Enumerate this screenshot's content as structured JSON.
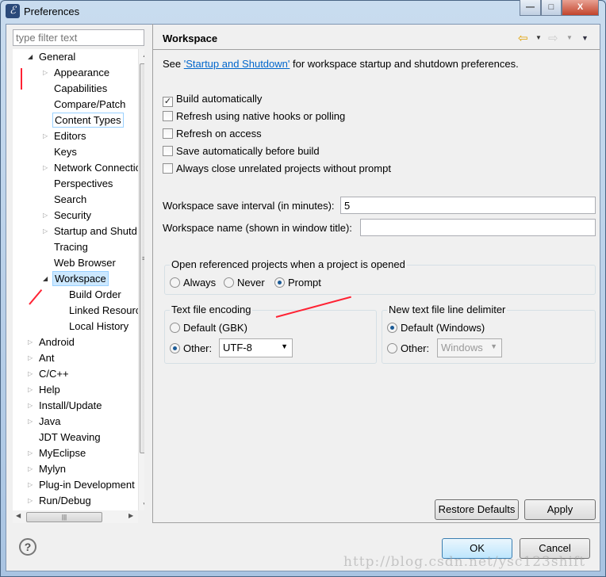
{
  "window": {
    "title": "Preferences",
    "minimize": "—",
    "maximize": "□",
    "close": "X"
  },
  "filter": {
    "placeholder": "type filter text"
  },
  "tree": [
    {
      "label": "General",
      "level": 0,
      "expander": "open"
    },
    {
      "label": "Appearance",
      "level": 1,
      "expander": "closed"
    },
    {
      "label": "Capabilities",
      "level": 1,
      "expander": "none"
    },
    {
      "label": "Compare/Patch",
      "level": 1,
      "expander": "none"
    },
    {
      "label": "Content Types",
      "level": 1,
      "expander": "none",
      "focused": true
    },
    {
      "label": "Editors",
      "level": 1,
      "expander": "closed"
    },
    {
      "label": "Keys",
      "level": 1,
      "expander": "none"
    },
    {
      "label": "Network Connectio",
      "level": 1,
      "expander": "closed"
    },
    {
      "label": "Perspectives",
      "level": 1,
      "expander": "none"
    },
    {
      "label": "Search",
      "level": 1,
      "expander": "none"
    },
    {
      "label": "Security",
      "level": 1,
      "expander": "closed"
    },
    {
      "label": "Startup and Shutd",
      "level": 1,
      "expander": "closed"
    },
    {
      "label": "Tracing",
      "level": 1,
      "expander": "none"
    },
    {
      "label": "Web Browser",
      "level": 1,
      "expander": "none"
    },
    {
      "label": "Workspace",
      "level": 1,
      "expander": "open",
      "selected": true
    },
    {
      "label": "Build Order",
      "level": 2,
      "expander": "none"
    },
    {
      "label": "Linked Resource",
      "level": 2,
      "expander": "none"
    },
    {
      "label": "Local History",
      "level": 2,
      "expander": "none"
    },
    {
      "label": "Android",
      "level": 0,
      "expander": "closed"
    },
    {
      "label": "Ant",
      "level": 0,
      "expander": "closed"
    },
    {
      "label": "C/C++",
      "level": 0,
      "expander": "closed"
    },
    {
      "label": "Help",
      "level": 0,
      "expander": "closed"
    },
    {
      "label": "Install/Update",
      "level": 0,
      "expander": "closed"
    },
    {
      "label": "Java",
      "level": 0,
      "expander": "closed"
    },
    {
      "label": "JDT Weaving",
      "level": 0,
      "expander": "none"
    },
    {
      "label": "MyEclipse",
      "level": 0,
      "expander": "closed"
    },
    {
      "label": "Mylyn",
      "level": 0,
      "expander": "closed"
    },
    {
      "label": "Plug-in Development",
      "level": 0,
      "expander": "closed"
    },
    {
      "label": "Run/Debug",
      "level": 0,
      "expander": "closed"
    }
  ],
  "page": {
    "title": "Workspace",
    "see_prefix": "See ",
    "see_link": "'Startup and Shutdown'",
    "see_suffix": " for workspace startup and shutdown preferences.",
    "checkboxes": [
      {
        "label": "Build automatically",
        "checked": true
      },
      {
        "label": "Refresh using native hooks or polling",
        "checked": false
      },
      {
        "label": "Refresh on access",
        "checked": false
      },
      {
        "label": "Save automatically before build",
        "checked": false
      },
      {
        "label": "Always close unrelated projects without prompt",
        "checked": false
      }
    ],
    "save_interval_label": "Workspace save interval (in minutes):",
    "save_interval_value": "5",
    "ws_name_label": "Workspace name (shown in window title):",
    "ws_name_value": "",
    "open_ref": {
      "label": "Open referenced projects when a project is opened",
      "options": [
        "Always",
        "Never",
        "Prompt"
      ],
      "selected": "Prompt"
    },
    "encoding": {
      "label": "Text file encoding",
      "default": "Default (GBK)",
      "other": "Other:",
      "value": "UTF-8",
      "selected": "Other"
    },
    "delimiter": {
      "label": "New text file line delimiter",
      "default": "Default (Windows)",
      "other": "Other:",
      "value": "Windows",
      "selected": "Default"
    },
    "restore_defaults": "Restore Defaults",
    "apply": "Apply"
  },
  "footer": {
    "ok": "OK",
    "cancel": "Cancel",
    "help": "?"
  },
  "watermark": "http://blog.csdn.net/ysc123shift",
  "colors": {
    "link": "#0066cc",
    "annotation_arrow": "#ff2233",
    "selection": "#cce8ff"
  }
}
